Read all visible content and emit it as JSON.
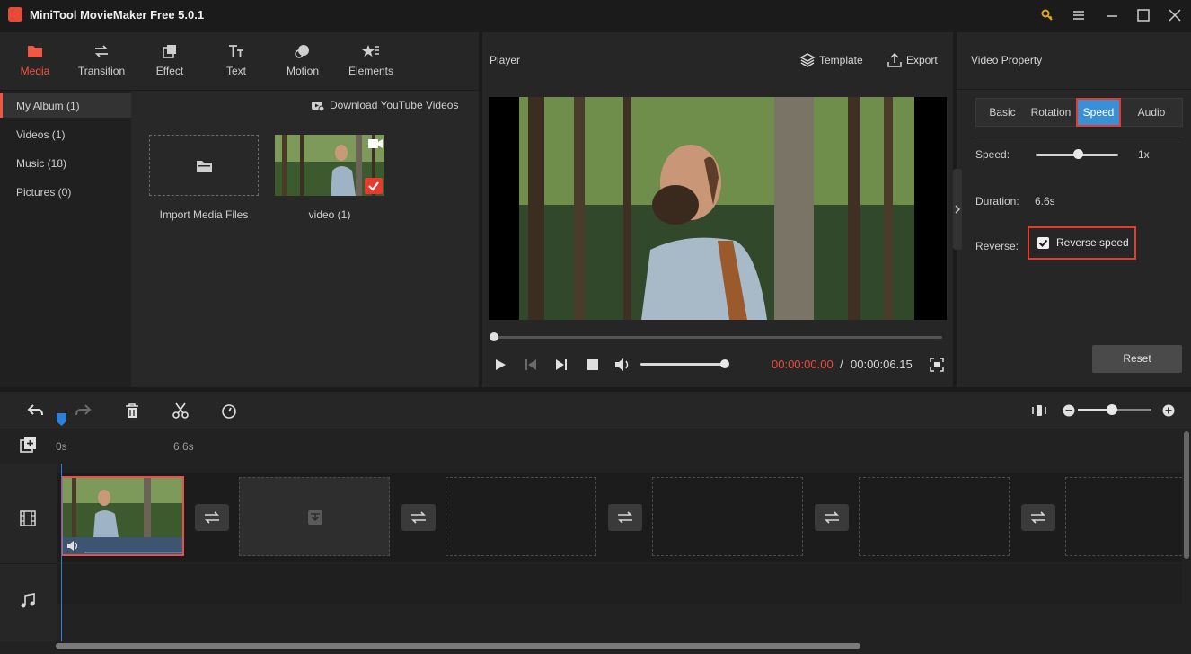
{
  "app": {
    "title": "MiniTool MovieMaker Free 5.0.1"
  },
  "toolbar": {
    "tabs": [
      {
        "label": "Media",
        "icon": "folder-icon"
      },
      {
        "label": "Transition",
        "icon": "transition-arrows-icon"
      },
      {
        "label": "Effect",
        "icon": "effect-icon"
      },
      {
        "label": "Text",
        "icon": "text-icon"
      },
      {
        "label": "Motion",
        "icon": "motion-icon"
      },
      {
        "label": "Elements",
        "icon": "elements-icon"
      }
    ],
    "active": "Media"
  },
  "sidebar": {
    "items": [
      {
        "label": "My Album (1)"
      },
      {
        "label": "Videos (1)"
      },
      {
        "label": "Music (18)"
      },
      {
        "label": "Pictures (0)"
      }
    ]
  },
  "media": {
    "download_label": "Download YouTube Videos",
    "import_label": "Import Media Files",
    "video_label": "video (1)"
  },
  "player": {
    "title": "Player",
    "template_label": "Template",
    "export_label": "Export",
    "time_current": "00:00:00.00",
    "time_separator": "/",
    "time_total": "00:00:06.15",
    "volume_level": 0.94
  },
  "property": {
    "title": "Video Property",
    "tabs": [
      "Basic",
      "Rotation",
      "Speed",
      "Audio"
    ],
    "active_tab": "Speed",
    "speed_label": "Speed:",
    "speed_value": "1x",
    "duration_label": "Duration:",
    "duration_value": "6.6s",
    "reverse_label": "Reverse:",
    "reverse_checkbox_label": "Reverse speed",
    "reverse_checked": true,
    "reset_label": "Reset"
  },
  "timeline": {
    "ruler_start": "0s",
    "ruler_mark": "6.6s",
    "zoom_level": 0.45
  },
  "colors": {
    "accent": "#ee5844",
    "highlight_box": "#e53a2e",
    "time_red": "#ee4a3a",
    "tab_active": "#3b8fd4",
    "playhead": "#2f7fd8"
  }
}
